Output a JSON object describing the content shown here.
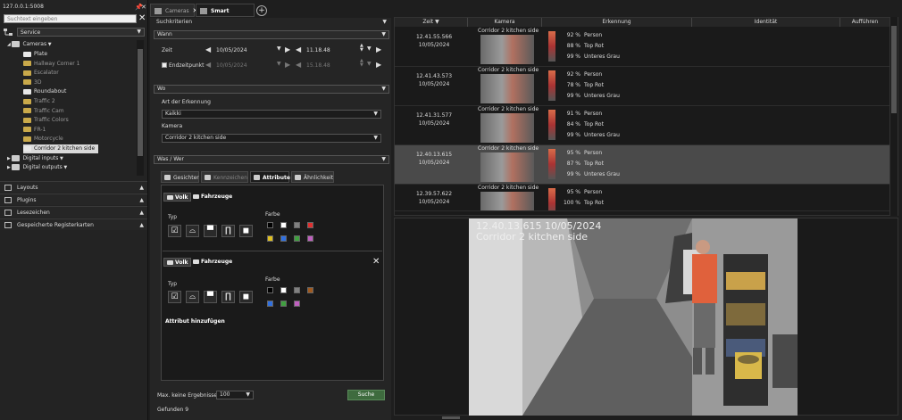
{
  "window": {
    "host": "127.0.0.1:5008"
  },
  "sidebar": {
    "search_placeholder": "Suchtext eingeben",
    "service_label": "Service",
    "tree": [
      {
        "label": "Cameras",
        "type": "folder",
        "level": 1
      },
      {
        "label": "Plate",
        "type": "camera-white",
        "level": 2
      },
      {
        "label": "Hallway Corner 1",
        "type": "camera",
        "level": 2,
        "dim": true
      },
      {
        "label": "Escalator",
        "type": "camera",
        "level": 2,
        "dim": true
      },
      {
        "label": "3D",
        "type": "camera",
        "level": 2,
        "dim": true
      },
      {
        "label": "Roundabout",
        "type": "camera-white",
        "level": 2
      },
      {
        "label": "Traffic 2",
        "type": "camera",
        "level": 2,
        "dim": true
      },
      {
        "label": "Traffic Cam",
        "type": "camera",
        "level": 2,
        "dim": true
      },
      {
        "label": "Traffic Colors",
        "type": "camera",
        "level": 2,
        "dim": true
      },
      {
        "label": "FR-1",
        "type": "camera",
        "level": 2,
        "dim": true
      },
      {
        "label": "Motorcycle",
        "type": "camera",
        "level": 2,
        "dim": true
      },
      {
        "label": "Corridor 2 kitchen side",
        "type": "camera-white",
        "level": 2,
        "selected": true
      },
      {
        "label": "Digital inputs",
        "type": "folder",
        "level": 1
      },
      {
        "label": "Digital outputs",
        "type": "folder",
        "level": 1
      }
    ],
    "sections": [
      "Layouts",
      "Plugins",
      "Lesezeichen",
      "Gespeicherte Registerkarten"
    ]
  },
  "tabs": [
    {
      "label": "Cameras",
      "active": false
    },
    {
      "label": "Smart Search",
      "active": true
    }
  ],
  "search": {
    "criteria_label": "Suchkriterien",
    "when_label": "Wann",
    "time_label": "Zeit",
    "date": "10/05/2024",
    "time": "11.18.48",
    "endpoint_label": "Endzeitpunkt",
    "end_date": "10/05/2024",
    "end_time": "15.18.48",
    "where_label": "Wo",
    "detection_type_label": "Art der Erkennung",
    "detection_type_value": "Kaikki",
    "camera_label": "Kamera",
    "camera_value": "Corridor 2 kitchen side",
    "who_label": "Was / Wer",
    "subtabs": [
      "Gesichter",
      "Kennzeichen",
      "Attribute",
      "Ähnlichkeit"
    ],
    "people_label": "Volk",
    "vehicles_label": "Fahrzeuge",
    "type_label": "Typ",
    "color_label": "Farbe",
    "add_attribute_label": "Attribut hinzufügen",
    "max_results_label": "Max. keine Ergebnisse",
    "max_results_value": "100",
    "search_button": "Suche",
    "found_label": "Gefunden 9",
    "colors_row1": [
      "#000000",
      "#ffffff",
      "#808080",
      "#e03030"
    ],
    "colors_row2": [
      "#e0c020",
      "#3070e0",
      "#40a040",
      "#c060c0"
    ],
    "colors2_row1": [
      "#000000",
      "#ffffff",
      "#808080",
      "#a05a20"
    ],
    "colors2_row2": [
      "#3070e0",
      "#40a040",
      "#c060c0"
    ]
  },
  "results": {
    "columns": [
      "Zeit",
      "Kamera",
      "Erkennung",
      "Identität",
      "Aufführen"
    ],
    "rows": [
      {
        "time": "12.41.55.566",
        "date": "10/05/2024",
        "camera": "Corridor 2 kitchen side",
        "detections": [
          {
            "pct": "92 %",
            "label": "Person"
          },
          {
            "pct": "88 %",
            "label": "Top Rot"
          },
          {
            "pct": "99 %",
            "label": "Unteres Grau"
          }
        ],
        "selected": false
      },
      {
        "time": "12.41.43.573",
        "date": "10/05/2024",
        "camera": "Corridor 2 kitchen side",
        "detections": [
          {
            "pct": "92 %",
            "label": "Person"
          },
          {
            "pct": "78 %",
            "label": "Top Rot"
          },
          {
            "pct": "99 %",
            "label": "Unteres Grau"
          }
        ],
        "selected": false
      },
      {
        "time": "12.41.31.577",
        "date": "10/05/2024",
        "camera": "Corridor 2 kitchen side",
        "detections": [
          {
            "pct": "91 %",
            "label": "Person"
          },
          {
            "pct": "84 %",
            "label": "Top Rot"
          },
          {
            "pct": "99 %",
            "label": "Unteres Grau"
          }
        ],
        "selected": false
      },
      {
        "time": "12.40.13.615",
        "date": "10/05/2024",
        "camera": "Corridor 2 kitchen side",
        "detections": [
          {
            "pct": "95 %",
            "label": "Person"
          },
          {
            "pct": "87 %",
            "label": "Top Rot"
          },
          {
            "pct": "99 %",
            "label": "Unteres Grau"
          }
        ],
        "selected": true
      },
      {
        "time": "12.39.57.622",
        "date": "10/05/2024",
        "camera": "Corridor 2 kitchen side",
        "detections": [
          {
            "pct": "95 %",
            "label": "Person"
          },
          {
            "pct": "100 %",
            "label": "Top Rot"
          },
          {
            "pct": "99 %",
            "label": "Unteres Grau"
          }
        ],
        "selected": false
      }
    ]
  },
  "video": {
    "timestamp": "12.40.13.615  10/05/2024",
    "camera": "Corridor 2 kitchen side"
  }
}
